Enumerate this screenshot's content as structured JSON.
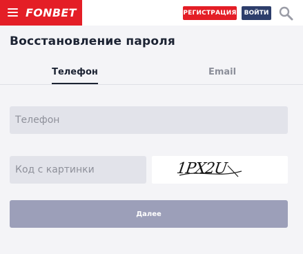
{
  "header": {
    "brand": "FONBET",
    "register_label": "РЕГИСТРАЦИЯ",
    "login_label": "ВОЙТИ",
    "menu_icon": "hamburger-menu-icon",
    "search_icon": "search-icon"
  },
  "page": {
    "title": "Восстановление пароля"
  },
  "tabs": [
    {
      "label": "Телефон",
      "active": true
    },
    {
      "label": "Email",
      "active": false
    }
  ],
  "form": {
    "phone_placeholder": "Телефон",
    "captcha_placeholder": "Код с картинки",
    "captcha_image_text": "1PX2U",
    "submit_label": "Далее"
  },
  "colors": {
    "brand_red": "#e41e26",
    "navy": "#2d3e6b",
    "submit_disabled": "#9c9fb9"
  }
}
